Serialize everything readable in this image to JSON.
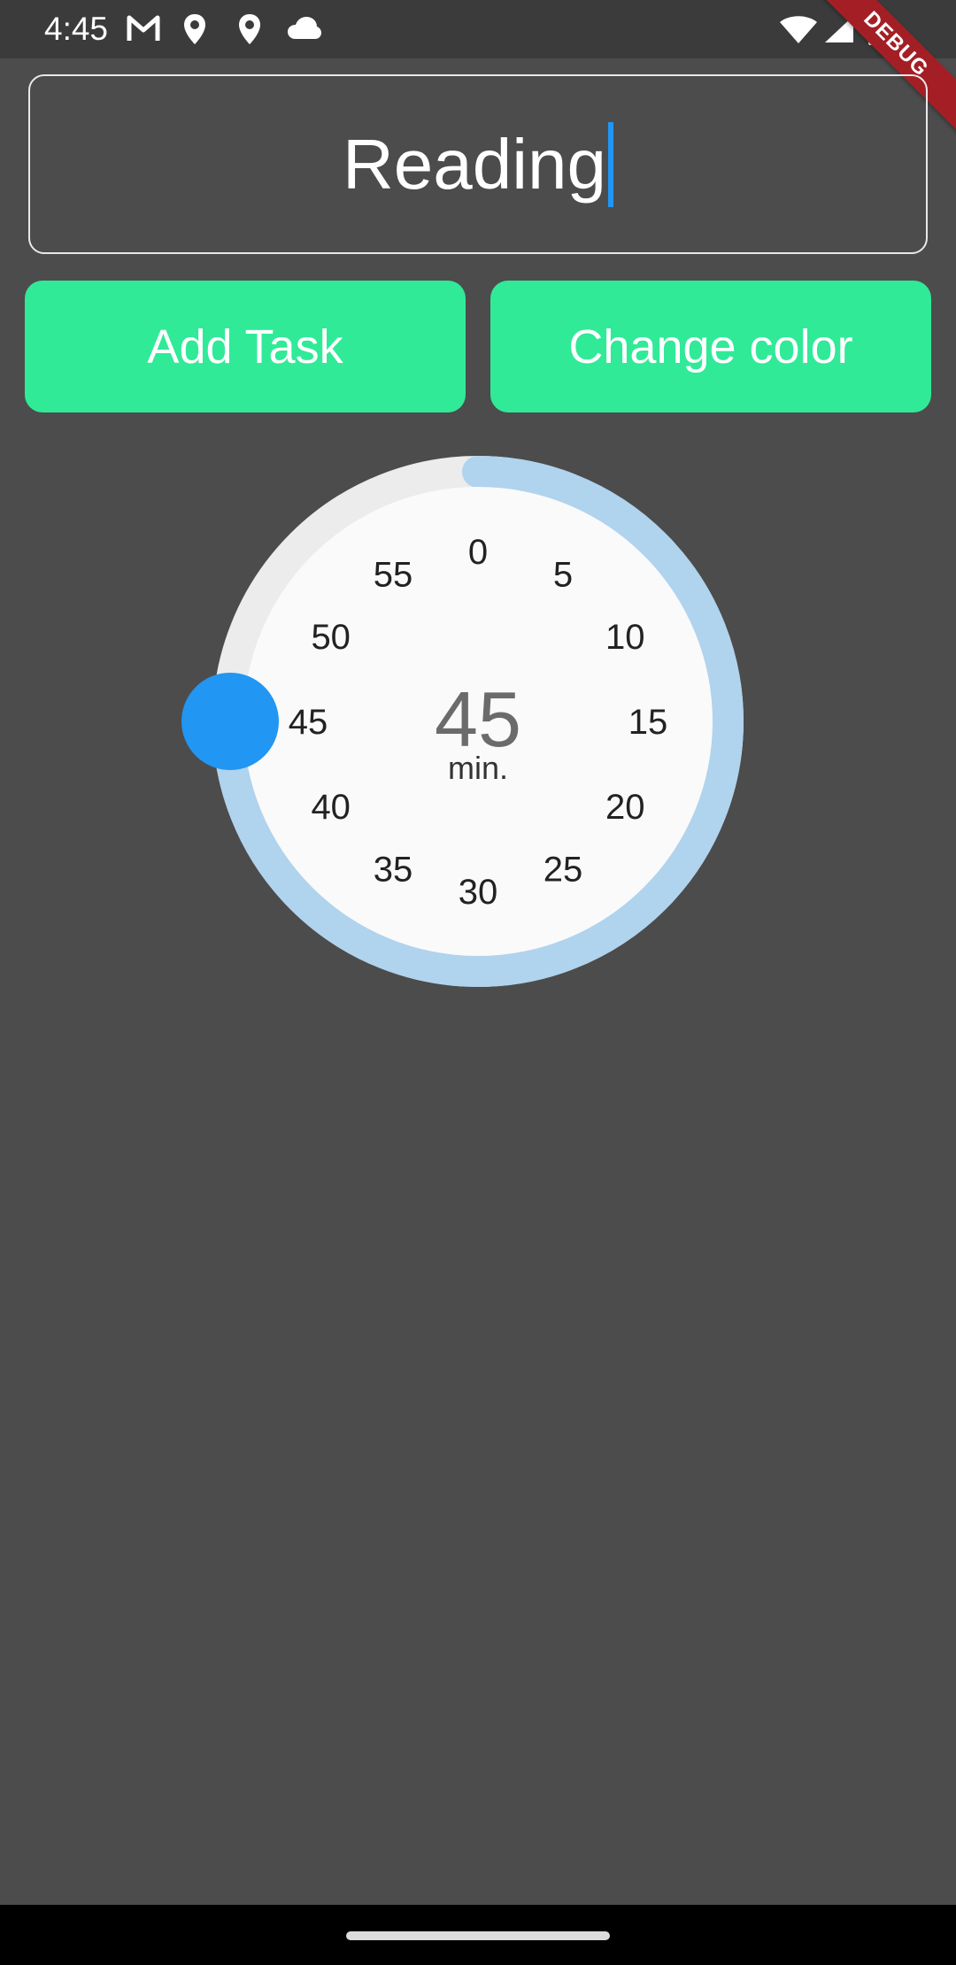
{
  "status_bar": {
    "time": "4:45",
    "left_icons": [
      "gmail-icon",
      "location-icon",
      "location-icon",
      "cloud-icon"
    ],
    "right_icons": [
      "wifi-icon",
      "signal-icon",
      "battery-icon"
    ]
  },
  "debug_banner": "DEBUG",
  "task_input": {
    "value": "Reading"
  },
  "buttons": {
    "add_task": "Add Task",
    "change_color": "Change color"
  },
  "timer": {
    "minutes": 45,
    "display_value": "45",
    "unit": "min.",
    "max_minutes": 60,
    "dial_labels": [
      "0",
      "5",
      "10",
      "15",
      "20",
      "25",
      "30",
      "35",
      "40",
      "45",
      "50",
      "55"
    ]
  },
  "colors": {
    "background": "#4c4c4c",
    "button": "#30ea98",
    "progress_track": "#ececec",
    "progress_fill": "#b0d3ee",
    "knob": "#2196f3",
    "dial_face": "#fafafa"
  }
}
